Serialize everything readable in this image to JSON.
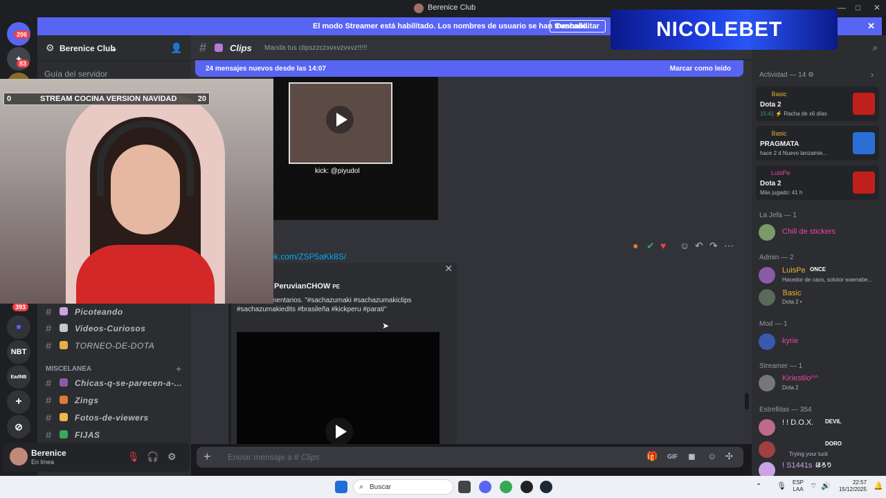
{
  "window": {
    "title": "Berenice Club",
    "controls": [
      "—",
      "□",
      "✕"
    ]
  },
  "streamer_banner": {
    "message": "El modo Streamer está habilitado. Los nombres de usuario se han truncado.",
    "button": "Deshabilitar",
    "close": "✕"
  },
  "servers": {
    "badge_top": "206",
    "badge_second": "83",
    "badge_mid": "393",
    "nbt": "NBT",
    "eadnb": "EadNB",
    "add": "+",
    "explore": "⊘"
  },
  "guild": {
    "name": "Berenice Club",
    "chevron": "⌄",
    "guide": "Guía del servidor"
  },
  "channels": [
    {
      "label": "Picoteando",
      "color": "#c9a3e6"
    },
    {
      "label": "Videos-Curiosos",
      "color": "#c8c8c8"
    },
    {
      "label": "TORNEO-DE-DOTA",
      "color": "#e8b040"
    }
  ],
  "category": {
    "label": "MISCELANEA",
    "plus": "+"
  },
  "channels_misc": [
    {
      "label": "Chicas-q-se-parecen-a-...",
      "color": "#8a5ca8"
    },
    {
      "label": "Zings",
      "color": "#e07a3a"
    },
    {
      "label": "Fotos-de-viewers",
      "color": "#f2b64a"
    },
    {
      "label": "FIJAS",
      "color": "#3ba55c"
    }
  ],
  "user_panel": {
    "name": "Berenice",
    "status": "En línea"
  },
  "channel_header": {
    "name": "Clips",
    "topic": "Manda tus clipszzczxvxvzvxvz!!!!!"
  },
  "new_messages": {
    "label": "24 mensajes nuevos desde las 14:07",
    "action": "Marcar como leído"
  },
  "clip": {
    "caption": "kick: @piyudol"
  },
  "message": {
    "link": "tok.com/ZSP5aKk8S/",
    "embed_author": "PeruvianCHOW",
    "embed_author_flag": "PE",
    "embed_desc": "sta, 122 comentarios. \"#sachazumaki #sachazumakiclips #sachazumakiedits #brasileña #kickperu #parati\"",
    "close": "✕"
  },
  "composer": {
    "placeholder": "Enviar mensaje a #",
    "channel": "Clips"
  },
  "members_panel": {
    "activity_header": "Actividad — 14",
    "activities": [
      {
        "user": "𝔹asic",
        "game": "Dota 2",
        "time": "15:41",
        "meta": "Racha de x6 días",
        "icon_color": "#c0201b"
      },
      {
        "user": "𝔹asic",
        "game": "PRAGMATA",
        "meta": "hace 2 d   Nuevo lanzamie...",
        "icon_color": "#2a6fd6"
      },
      {
        "user": "LuisPe",
        "game": "Dota 2",
        "meta": "Más jugado: 41 h",
        "icon_color": "#c0201b"
      }
    ],
    "groups": [
      {
        "header": "La Jefa — 1",
        "members": [
          {
            "name": "Chill de stickers",
            "color": "#eb459e",
            "sub": ""
          }
        ]
      },
      {
        "header": "Admin — 2",
        "members": [
          {
            "name": "LuisPe",
            "color": "#f0b232",
            "tag": "ONCE",
            "sub": "Hacedor de caos, solutor waenabe..."
          },
          {
            "name": "𝔹asic",
            "color": "#f0b232",
            "sub": "Dota 2 •"
          }
        ]
      },
      {
        "header": "Mod — 1",
        "members": [
          {
            "name": "kyrie",
            "color": "#eb459e",
            "sub": ""
          }
        ]
      },
      {
        "header": "Streamer — 1",
        "members": [
          {
            "name": "Kiriestilo^^",
            "color": "#eb459e",
            "sub": "Dota 2"
          }
        ]
      },
      {
        "header": "Estrellitas — 354",
        "members": [
          {
            "name": "! ! D.O.X.",
            "color": "#f2f3f5",
            "tag": "DEVIL",
            "sub": ""
          },
          {
            "name": "",
            "color": "#f23f43",
            "tag": "DORO",
            "sub": "Trying your luck"
          },
          {
            "name": "! S1441s",
            "color": "#c9a3e6",
            "tag": "ほろり",
            "sub": ""
          }
        ]
      }
    ]
  },
  "webcam": {
    "left_count": "0",
    "title": "STREAM COCINA VERSION NAVIDAD",
    "right_count": "20"
  },
  "overlay_logo": "NICOLEBET",
  "taskbar": {
    "search": "Buscar",
    "lang_top": "ESP",
    "lang_bottom": "LAA",
    "time": "22:57",
    "date": "15/12/2025"
  }
}
